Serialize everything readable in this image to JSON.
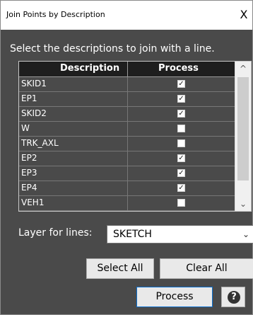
{
  "window": {
    "title": "Join Points by Description",
    "close_glyph": "X"
  },
  "instruction": "Select the descriptions to join with a line.",
  "table": {
    "headers": {
      "description": "Description",
      "process": "Process"
    },
    "rows": [
      {
        "description": "SKID1",
        "process": true
      },
      {
        "description": "EP1",
        "process": true
      },
      {
        "description": "SKID2",
        "process": true
      },
      {
        "description": "W",
        "process": false
      },
      {
        "description": "TRK_AXL",
        "process": false
      },
      {
        "description": "EP2",
        "process": true
      },
      {
        "description": "EP3",
        "process": true
      },
      {
        "description": "EP4",
        "process": true
      },
      {
        "description": "VEH1",
        "process": false
      }
    ]
  },
  "layer": {
    "label": "Layer for lines:",
    "value": "SKETCH"
  },
  "buttons": {
    "select_all": "Select All",
    "clear_all": "Clear All",
    "process": "Process",
    "help": "?"
  },
  "icons": {
    "close": "close-icon",
    "chevron": "chevron-down-icon",
    "help": "help-icon",
    "check": "checkmark-icon"
  },
  "colors": {
    "panel": "#4a4a4a",
    "header": "#1e1e1e",
    "accent": "#0b6fcf"
  }
}
